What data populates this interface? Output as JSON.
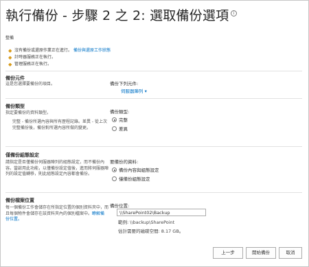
{
  "page": {
    "title": "執行備份 - 步驟 2 之 2: 選取備份選項",
    "info_icon": "i"
  },
  "readiness": {
    "label": "整備",
    "items": [
      {
        "text": "沒有備份或還原作業正在進行。",
        "link": "備份與還原工作狀態"
      },
      {
        "text": "計時器服務正在執行。",
        "link": ""
      },
      {
        "text": "管理服務正在執行。",
        "link": ""
      }
    ],
    "status_icon": "check-warning-icon"
  },
  "backup_component": {
    "heading": "備份元件",
    "description": "這是您選擇要備份的項目。",
    "field_label": "備份下列元件:",
    "selected": "伺服器陣列",
    "dropdown_arrow": "▾"
  },
  "backup_type": {
    "heading": "備份類型",
    "description": "指定要備份的資料類型。",
    "description_detail": "完整 - 備份所選內容與所有歷程記錄。差異 - 從上次完整備份後，備份對所選內容所做的變更。",
    "field_label": "備份類型:",
    "options": [
      "完整",
      "差異"
    ],
    "selected": "完整"
  },
  "backup_config": {
    "heading": "僅備份組態設定",
    "description": "請指定是否僅備份伺服器陣列的組態設定，而不備份內容。當啟用此功能，以僅備份設定值後，進而將伺服器陣列的設定值轉移，則此組態設定內容都會備份。",
    "field_label": "要備份的資料:",
    "options": [
      "備份內容與組態設定",
      "僅備份組態設定"
    ],
    "selected": "備份內容與組態設定"
  },
  "backup_location": {
    "heading": "備份檔案位置",
    "description": "每一個備份工作會儲存在所指定位置的個別資料夾中，而且每個物件會儲存在該資料夾內的個別檔案中。",
    "link": "瞭解備份位置。",
    "field_label": "備份位置:",
    "value": "\\\\SharePoint02\\Backup",
    "example": "範例: \\\\backup\\SharePoint",
    "estimate": "估計需要的磁碟空間: 8.17 GB。"
  },
  "buttons": {
    "back": "上一步",
    "start": "開始備份",
    "cancel": "取消"
  }
}
